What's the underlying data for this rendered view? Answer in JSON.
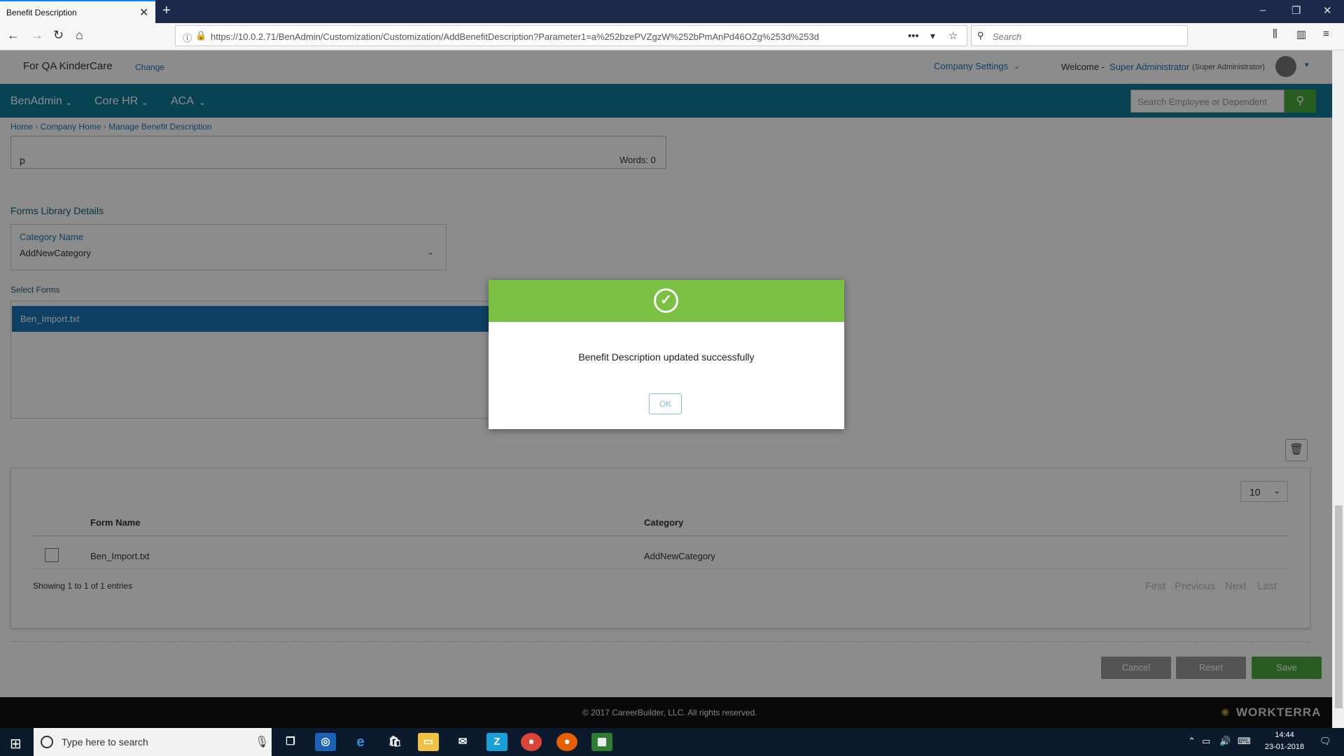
{
  "browser": {
    "tab_title": "Benefit Description",
    "tab_close": "✕",
    "new_tab": "+",
    "url": "https://10.0.2.71/BenAdmin/Customization/Customization/AddBenefitDescription?Parameter1=a%252bzePVZgzW%252bPmAnPd46OZg%253d%253d",
    "search_placeholder": "Search"
  },
  "header": {
    "company": "For QA KinderCare",
    "change_link": "Change",
    "company_settings": "Company Settings",
    "welcome": "Welcome -",
    "user": "Super Administrator",
    "role": "(Super Administrator)"
  },
  "nav": {
    "items": [
      "BenAdmin",
      "Core HR",
      "ACA"
    ],
    "employee_search_placeholder": "Search Employee or Dependent"
  },
  "breadcrumb": [
    "Home",
    "Company Home",
    "Manage Benefit Description"
  ],
  "editor": {
    "text": "p",
    "words": "Words: 0"
  },
  "forms_library": {
    "title": "Forms Library Details",
    "category_label": "Category Name",
    "category_value": "AddNewCategory",
    "select_forms_label": "Select Forms",
    "forms": [
      "Ben_Import.txt"
    ]
  },
  "table": {
    "page_size": "10",
    "columns": [
      "Form Name",
      "Category"
    ],
    "rows": [
      {
        "form": "Ben_Import.txt",
        "category": "AddNewCategory"
      }
    ],
    "showing": "Showing 1 to 1 of 1 entries",
    "pager": [
      "First",
      "Previous",
      "Next",
      "Last"
    ]
  },
  "actions": {
    "cancel": "Cancel",
    "reset": "Reset",
    "save": "Save"
  },
  "footer": {
    "copyright": "© 2017 CareerBuilder, LLC. All rights reserved.",
    "brand": "WORKTERRA"
  },
  "modal": {
    "message": "Benefit Description updated successfully",
    "ok": "OK",
    "check_icon": "✓"
  },
  "taskbar": {
    "search_placeholder": "Type here to search",
    "time": "14:44",
    "date": "23-01-2018"
  },
  "colors": {
    "nav_bg": "#0e7a98",
    "success_green": "#7ac143",
    "link_blue": "#1a76b5",
    "selected_row": "#1a76b5"
  }
}
